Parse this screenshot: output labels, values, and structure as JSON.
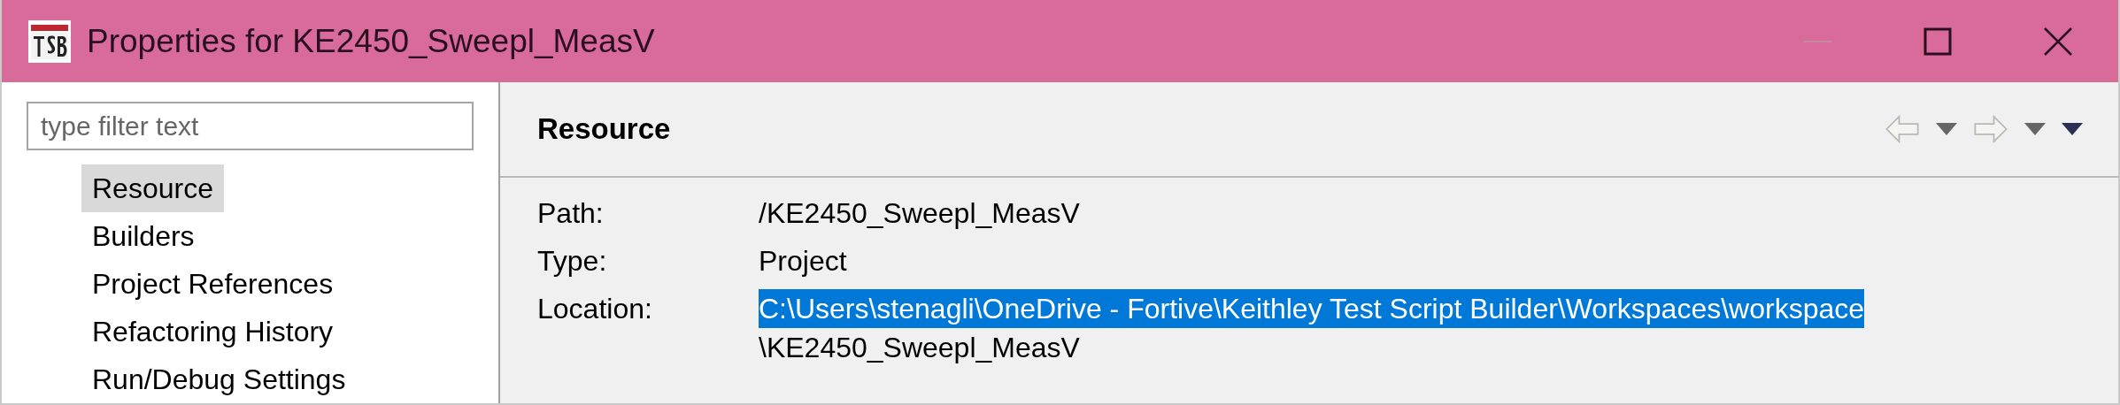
{
  "window": {
    "title": "Properties for KE2450_Sweepl_MeasV"
  },
  "sidebar": {
    "filter": {
      "placeholder": "type filter text"
    },
    "items": [
      {
        "label": "Resource",
        "selected": true
      },
      {
        "label": "Builders",
        "selected": false
      },
      {
        "label": "Project References",
        "selected": false
      },
      {
        "label": "Refactoring History",
        "selected": false
      },
      {
        "label": "Run/Debug Settings",
        "selected": false
      }
    ]
  },
  "page": {
    "title": "Resource",
    "nav": {
      "back_disabled": true,
      "forward_disabled": true
    },
    "properties": [
      {
        "label": "Path:",
        "lines": [
          {
            "text": "/KE2450_Sweepl_MeasV",
            "selected": false
          }
        ]
      },
      {
        "label": "Type:",
        "lines": [
          {
            "text": "Project",
            "selected": false
          }
        ]
      },
      {
        "label": "Location:",
        "lines": [
          {
            "text": "C:\\Users\\stenagli\\OneDrive - Fortive\\Keithley Test Script Builder\\Workspaces\\workspace",
            "selected": true
          },
          {
            "text": "\\KE2450_Sweepl_MeasV",
            "selected": false
          }
        ]
      }
    ]
  }
}
